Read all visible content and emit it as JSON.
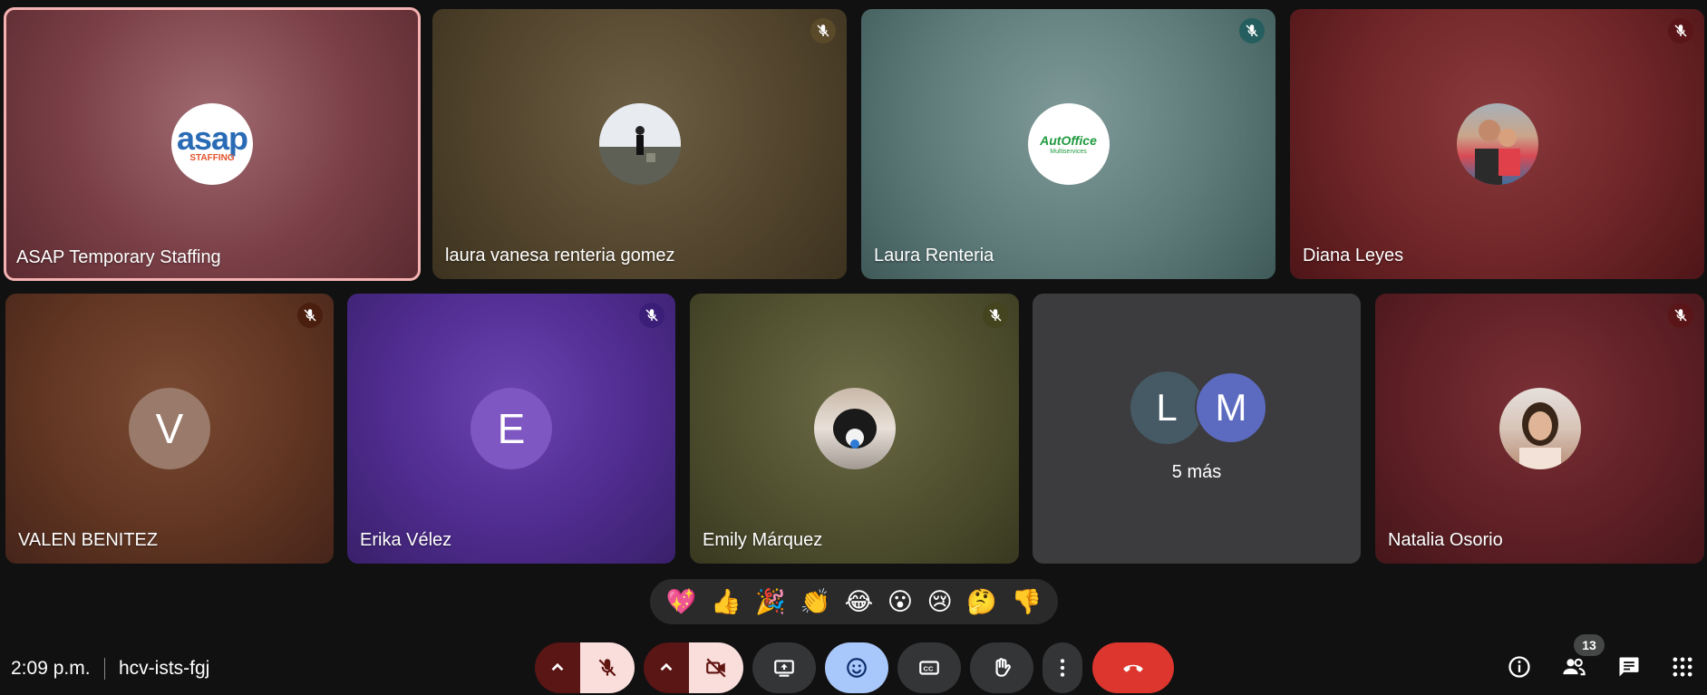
{
  "tiles": [
    {
      "name": "ASAP Temporary Staffing",
      "avatar_text": "",
      "avatar_type": "logo-asap",
      "logo_top": "asap",
      "logo_bottom": "STAFFING",
      "muted": false
    },
    {
      "name": "laura vanesa renteria gomez",
      "avatar_type": "photo",
      "muted": true
    },
    {
      "name": "Laura Renteria",
      "avatar_type": "logo-autoffice",
      "logo_top": "AutOffice",
      "logo_bottom": "Multiservices",
      "muted": true
    },
    {
      "name": "Diana Leyes",
      "avatar_type": "photo",
      "muted": true
    },
    {
      "name": "VALEN BENITEZ",
      "avatar_text": "V",
      "muted": true
    },
    {
      "name": "Erika Vélez",
      "avatar_text": "E",
      "muted": true
    },
    {
      "name": "Emily Márquez",
      "avatar_type": "photo",
      "muted": true
    },
    {
      "name": "",
      "avatar_text_1": "L",
      "avatar_text_2": "M",
      "more_label": "5 más"
    },
    {
      "name": "Natalia Osorio",
      "avatar_type": "photo",
      "muted": true
    }
  ],
  "reactions": [
    "💖",
    "👍",
    "🎉",
    "👏",
    "😂",
    "😮",
    "😢",
    "🤔",
    "👎"
  ],
  "footer": {
    "time": "2:09 p.m.",
    "meeting_code": "hcv-ists-fgj",
    "participants_count": "13"
  },
  "colors": {
    "end_call": "#dc362e",
    "mic_muted_bg": "#f9dedc",
    "emoji_active": "#a8c7fa"
  }
}
